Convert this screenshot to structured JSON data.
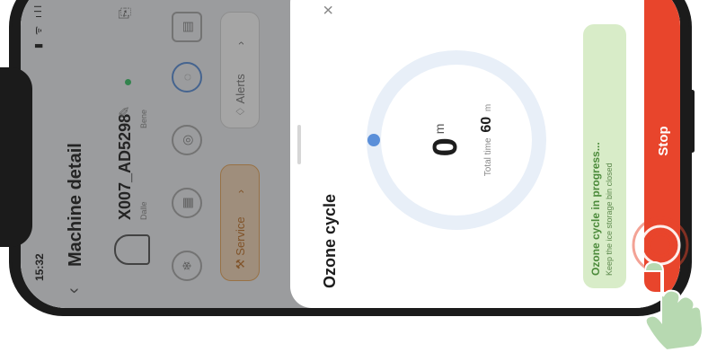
{
  "status_bar": {
    "time": "15:32",
    "icons": "▮ ᯤ ıll"
  },
  "page": {
    "title": "Machine detail",
    "back_icon": "chevron-left-icon"
  },
  "machine": {
    "name": "X007_AD5298",
    "sub_left": "Dalle",
    "sub_right": "Bene",
    "online_color": "#3cc46a"
  },
  "actions": {
    "service_label": "Service",
    "alerts_label": "Alerts"
  },
  "sheet": {
    "title": "Ozone cycle",
    "remaining_value": "0",
    "remaining_unit": "m",
    "total_label": "Total time",
    "total_value": "60",
    "total_unit": "m",
    "progress_fraction": 0.0,
    "status_title": "Ozone cycle in progress...",
    "status_subtitle": "Keep the ice storage bin closed",
    "stop_label": "Stop"
  },
  "colors": {
    "stop": "#e8452c",
    "status_bg": "#d8ecc8",
    "ring": "#e8eff8",
    "progress_dot": "#5b8fd9",
    "service": "#e8a65a"
  }
}
